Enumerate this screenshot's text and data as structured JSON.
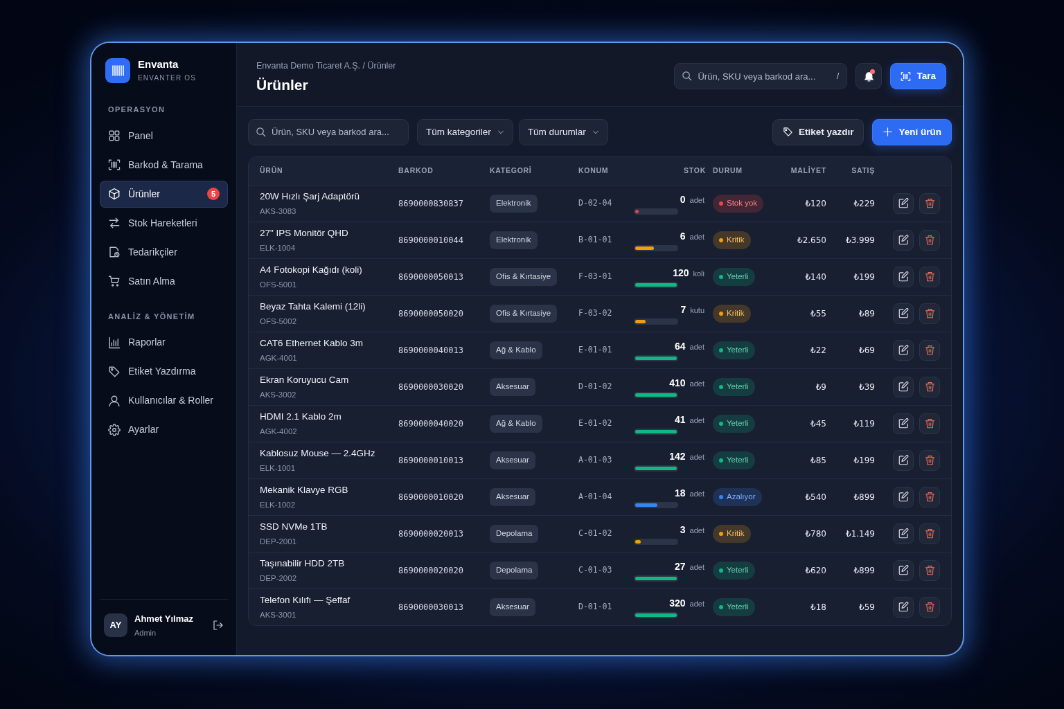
{
  "sidebar": {
    "brand": {
      "name": "Envanta",
      "tagline": "ENVANTER OS"
    },
    "sections": [
      {
        "title": "OPERASYON",
        "items": [
          {
            "label": "Panel",
            "selected": false
          },
          {
            "label": "Barkod & Tarama",
            "selected": false
          },
          {
            "label": "Ürünler",
            "selected": true,
            "badge": "5"
          },
          {
            "label": "Stok Hareketleri",
            "selected": false
          },
          {
            "label": "Tedarikçiler",
            "selected": false
          },
          {
            "label": "Satın Alma",
            "selected": false
          }
        ]
      },
      {
        "title": "ANALİZ & YÖNETİM",
        "items": [
          {
            "label": "Raporlar",
            "selected": false
          },
          {
            "label": "Etiket Yazdırma",
            "selected": false
          },
          {
            "label": "Kullanıcılar & Roller",
            "selected": false
          },
          {
            "label": "Ayarlar",
            "selected": false
          }
        ]
      }
    ],
    "user": {
      "initials": "AY",
      "name": "Ahmet Yılmaz",
      "role": "Admin"
    }
  },
  "header": {
    "breadcrumb": "Envanta Demo Ticaret A.Ş. / Ürünler",
    "title": "Ürünler",
    "search": {
      "placeholder": "Ürün, SKU veya barkod ara...",
      "shortcut": "/"
    },
    "notifications": {
      "unread": true
    },
    "scan_button": "Tara"
  },
  "toolbar": {
    "search": {
      "placeholder": "Ürün, SKU veya barkod ara..."
    },
    "filters": [
      "Tüm kategoriler",
      "Tüm durumlar"
    ],
    "buttons": [
      {
        "label": "Etiket yazdır",
        "kind": "secondary"
      },
      {
        "label": "Yeni ürün",
        "kind": "primary"
      }
    ]
  },
  "table": {
    "columns": [
      "ÜRÜN",
      "BARKOD",
      "KATEGORİ",
      "KONUM",
      "STOK",
      "DURUM",
      "MALİYET",
      "SATIŞ"
    ],
    "rows": [
      {
        "name": "20W Hızlı Şarj Adaptörü",
        "sku": "AKS-3083",
        "barcode": "8690000830837",
        "category": "Elektronik",
        "location": "D-02-04",
        "stock": "0",
        "unit": "adet",
        "level": 0.08,
        "status": {
          "label": "Stok yok",
          "color": "#ef4444"
        },
        "cost": "₺120",
        "price": "₺229"
      },
      {
        "name": "27\" IPS Monitör QHD",
        "sku": "ELK-1004",
        "barcode": "8690000010044",
        "category": "Elektronik",
        "location": "B-01-01",
        "stock": "6",
        "unit": "adet",
        "level": 0.45,
        "status": {
          "label": "Kritik",
          "color": "#f59e0b"
        },
        "cost": "₺2.650",
        "price": "₺3.999"
      },
      {
        "name": "A4 Fotokopi Kağıdı (koli)",
        "sku": "OFS-5001",
        "barcode": "8690000050013",
        "category": "Ofis & Kırtasiye",
        "location": "F-03-01",
        "stock": "120",
        "unit": "koli",
        "level": 1,
        "status": {
          "label": "Yeterli",
          "color": "#10b981"
        },
        "cost": "₺140",
        "price": "₺199"
      },
      {
        "name": "Beyaz Tahta Kalemi (12li)",
        "sku": "OFS-5002",
        "barcode": "8690000050020",
        "category": "Ofis & Kırtasiye",
        "location": "F-03-02",
        "stock": "7",
        "unit": "kutu",
        "level": 0.25,
        "status": {
          "label": "Kritik",
          "color": "#f59e0b"
        },
        "cost": "₺55",
        "price": "₺89"
      },
      {
        "name": "CAT6 Ethernet Kablo 3m",
        "sku": "AGK-4001",
        "barcode": "8690000040013",
        "category": "Ağ & Kablo",
        "location": "E-01-01",
        "stock": "64",
        "unit": "adet",
        "level": 1,
        "status": {
          "label": "Yeterli",
          "color": "#10b981"
        },
        "cost": "₺22",
        "price": "₺69"
      },
      {
        "name": "Ekran Koruyucu Cam",
        "sku": "AKS-3002",
        "barcode": "8690000030020",
        "category": "Aksesuar",
        "location": "D-01-02",
        "stock": "410",
        "unit": "adet",
        "level": 1,
        "status": {
          "label": "Yeterli",
          "color": "#10b981"
        },
        "cost": "₺9",
        "price": "₺39"
      },
      {
        "name": "HDMI 2.1 Kablo 2m",
        "sku": "AGK-4002",
        "barcode": "8690000040020",
        "category": "Ağ & Kablo",
        "location": "E-01-02",
        "stock": "41",
        "unit": "adet",
        "level": 1,
        "status": {
          "label": "Yeterli",
          "color": "#10b981"
        },
        "cost": "₺45",
        "price": "₺119"
      },
      {
        "name": "Kablosuz Mouse — 2.4GHz",
        "sku": "ELK-1001",
        "barcode": "8690000010013",
        "category": "Aksesuar",
        "location": "A-01-03",
        "stock": "142",
        "unit": "adet",
        "level": 1,
        "status": {
          "label": "Yeterli",
          "color": "#10b981"
        },
        "cost": "₺85",
        "price": "₺199"
      },
      {
        "name": "Mekanik Klavye RGB",
        "sku": "ELK-1002",
        "barcode": "8690000010020",
        "category": "Aksesuar",
        "location": "A-01-04",
        "stock": "18",
        "unit": "adet",
        "level": 0.53,
        "status": {
          "label": "Azalıyor",
          "color": "#3b82f6"
        },
        "cost": "₺540",
        "price": "₺899"
      },
      {
        "name": "SSD NVMe 1TB",
        "sku": "DEP-2001",
        "barcode": "8690000020013",
        "category": "Depolama",
        "location": "C-01-02",
        "stock": "3",
        "unit": "adet",
        "level": 0.14,
        "status": {
          "label": "Kritik",
          "color": "#f59e0b"
        },
        "cost": "₺780",
        "price": "₺1.149"
      },
      {
        "name": "Taşınabilir HDD 2TB",
        "sku": "DEP-2002",
        "barcode": "8690000020020",
        "category": "Depolama",
        "location": "C-01-03",
        "stock": "27",
        "unit": "adet",
        "level": 1,
        "status": {
          "label": "Yeterli",
          "color": "#10b981"
        },
        "cost": "₺620",
        "price": "₺899"
      },
      {
        "name": "Telefon Kılıfı — Şeffaf",
        "sku": "AKS-3001",
        "barcode": "8690000030013",
        "category": "Aksesuar",
        "location": "D-01-01",
        "stock": "320",
        "unit": "adet",
        "level": 1,
        "status": {
          "label": "Yeterli",
          "color": "#10b981"
        },
        "cost": "₺18",
        "price": "₺59"
      }
    ]
  }
}
